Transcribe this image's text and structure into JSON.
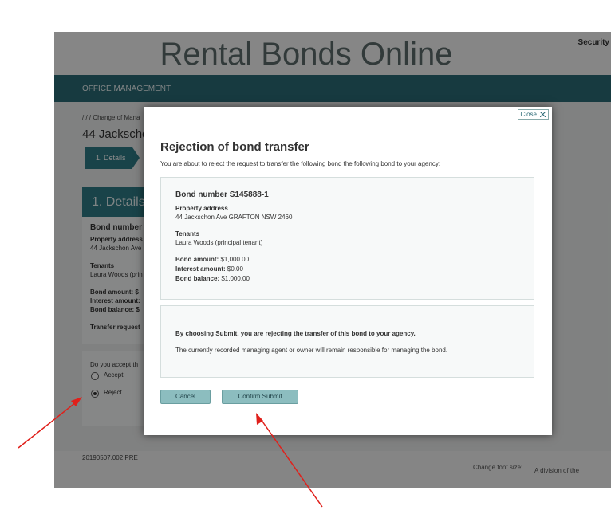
{
  "header": {
    "title": "Rental Bonds Online",
    "security": "Security"
  },
  "nav": {
    "label": "OFFICE MANAGEMENT"
  },
  "breadcrumb": "/ / / Change of Mana",
  "page_title": "44 Jackschon",
  "steps": [
    {
      "label": "1. Details"
    }
  ],
  "details": {
    "heading": "1. Details",
    "bond_number": "Bond number",
    "property_address_label": "Property address",
    "property_address": "44 Jackschon Ave",
    "tenants_label": "Tenants",
    "tenants": "Laura Woods (prin",
    "bond_amount": "Bond amount: $",
    "interest_amount": "Interest amount:",
    "bond_balance": "Bond balance: $",
    "transfer_request": "Transfer request"
  },
  "question": {
    "text": "Do you accept th",
    "options": [
      {
        "label": "Accept",
        "selected": false
      },
      {
        "label": "Reject",
        "selected": true
      }
    ]
  },
  "footer": {
    "version": "20190507.002 PRE",
    "change_font": "Change font size:",
    "division": "A division of the"
  },
  "modal": {
    "close_label": "Close",
    "title": "Rejection of bond transfer",
    "intro": "You are about to reject the request to transfer the following bond the following bond to your agency:",
    "bond_number": "Bond number S145888-1",
    "property_address_label": "Property address",
    "property_address": "44 Jackschon Ave GRAFTON NSW 2460",
    "tenants_label": "Tenants",
    "tenants": "Laura Woods (principal tenant)",
    "bond_amount_label": "Bond amount:",
    "bond_amount": "$1,000.00",
    "interest_amount_label": "Interest amount:",
    "interest_amount": "$0.00",
    "bond_balance_label": "Bond balance:",
    "bond_balance": "$1,000.00",
    "warning": "By choosing Submit, you are rejecting the transfer of this bond to your agency.",
    "note": "The currently recorded managing agent or owner will remain responsible for managing the bond.",
    "cancel_label": "Cancel",
    "confirm_label": "Confirm Submit"
  },
  "colors": {
    "nav": "#2b6a76",
    "button": "#8cbdbf",
    "arrow": "#e0201b"
  }
}
